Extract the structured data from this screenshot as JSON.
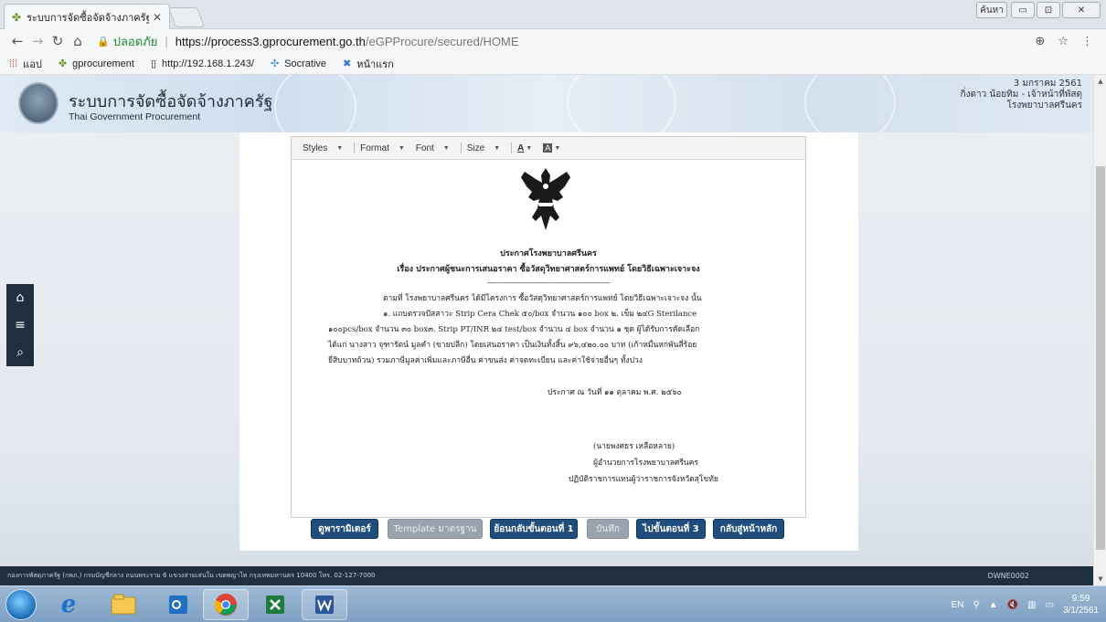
{
  "browser": {
    "tab_title": "ระบบการจัดซื้อจัดจ้างภาครัฐ",
    "url_secure_label": "ปลอดภัย",
    "url_host": "https://process3.gprocurement.go.th",
    "url_path": "/eGPProcure/secured/HOME",
    "window_buttons": [
      "ค้นหา",
      "▭",
      "⊡",
      "✕"
    ],
    "bookmarks": [
      {
        "icon": "apps-grid-icon",
        "label": "แอป"
      },
      {
        "icon": "gprocurement-icon",
        "label": "gprocurement"
      },
      {
        "icon": "page-icon",
        "label": "http://192.168.1.243/"
      },
      {
        "icon": "socrative-icon",
        "label": "Socrative"
      },
      {
        "icon": "home-x-icon",
        "label": "หน้าแรก"
      }
    ]
  },
  "header": {
    "system_title": "ระบบการจัดซื้อจัดจ้างภาครัฐ",
    "system_subtitle": "Thai Government Procurement",
    "date": "3 มกราคม 2561",
    "user_name": "กิ่งดาว น้อยทิม - เจ้าหน้าที่พัสดุ",
    "organization": "โรงพยาบาลศรีนคร"
  },
  "sidebar": {
    "buttons": [
      {
        "icon": "home-icon",
        "glyph": "⌂"
      },
      {
        "icon": "menu-icon",
        "glyph": "≡"
      },
      {
        "icon": "search-icon",
        "glyph": "⌕"
      }
    ]
  },
  "editor": {
    "toolbar": {
      "styles": "Styles",
      "format": "Format",
      "font": "Font",
      "size": "Size",
      "text_color": "A",
      "bg_color": "A"
    },
    "document": {
      "announcement_title": "ประกาศโรงพยาบาลศรีนคร",
      "subject": "เรื่อง ประกาศผู้ชนะการเสนอราคา ซื้อวัสดุวิทยาศาสตร์การแพทย์ โดยวิธีเฉพาะเจาะจง",
      "separator": "------------------------------------------------------------------------",
      "para1": "ตามที่ โรงพยาบาลศรีนคร ได้มีโครงการ ซื้อวัสดุวิทยาศาสตร์การแพทย์ โดยวิธีเฉพาะเจาะจง  นั้น",
      "para2": "๑. แถบตรวจปัสสาวะ Strip Cera Chek ๕๐/box จำนวน ๑๐๐ box ๒. เข็ม ๒๔G Sterilance",
      "para3": "๑๐๐pcs/box จำนวน ๓๐ box๓. Strip PT/INR ๒๔ test/box จำนวน ๔ box จำนวน ๑ ชุด ผู้ได้รับการคัดเลือก",
      "para4": "ได้แก่ นางสาว จุฑารัตน์ มูลคำ (ขายปลีก) โดยเสนอราคา เป็นเงินทั้งสิ้น ๙๖,๔๒๐.๐๐ บาท (เก้าหมื่นหกพันสี่ร้อย",
      "para5": "ยี่สิบบาทถ้วน) รวมภาษีมูลค่าเพิ่มและภาษีอื่น ค่าขนส่ง ค่าจดทะเบียน และค่าใช้จ่ายอื่นๆ ทั้งปวง",
      "announce_date": "ประกาศ ณ วันที่  ๑๑ ตุลาคม พ.ศ. ๒๕๖๐",
      "signer_name": "(นายพงศธร เหลือหลาย)",
      "signer_title": "ผู้อำนวยการโรงพยาบาลศรีนคร",
      "signer_role": "ปฏิบัติราชการแทนผู้ว่าราชการจังหวัดสุโขทัย"
    }
  },
  "actions": {
    "parameter": "ดูพารามิเตอร์",
    "template": "Template มาตรฐาน",
    "back_step": "ย้อนกลับขั้นตอนที่ 1",
    "save": "บันทึก",
    "next_step": "ไปขั้นตอนที่ 3",
    "home": "กลับสู่หน้าหลัก"
  },
  "footer": {
    "address": "กองการพัสดุภาครัฐ (กพภ.) กรมบัญชีกลาง ถนนพระราม 6 แขวงสามเสนใน เขตพญาไท กรุงเทพมหานคร 10400 โทร. 02-127-7000",
    "page_code": "DWNE0002"
  },
  "taskbar": {
    "language": "EN",
    "time": "9:59",
    "date": "3/1/2561"
  }
}
